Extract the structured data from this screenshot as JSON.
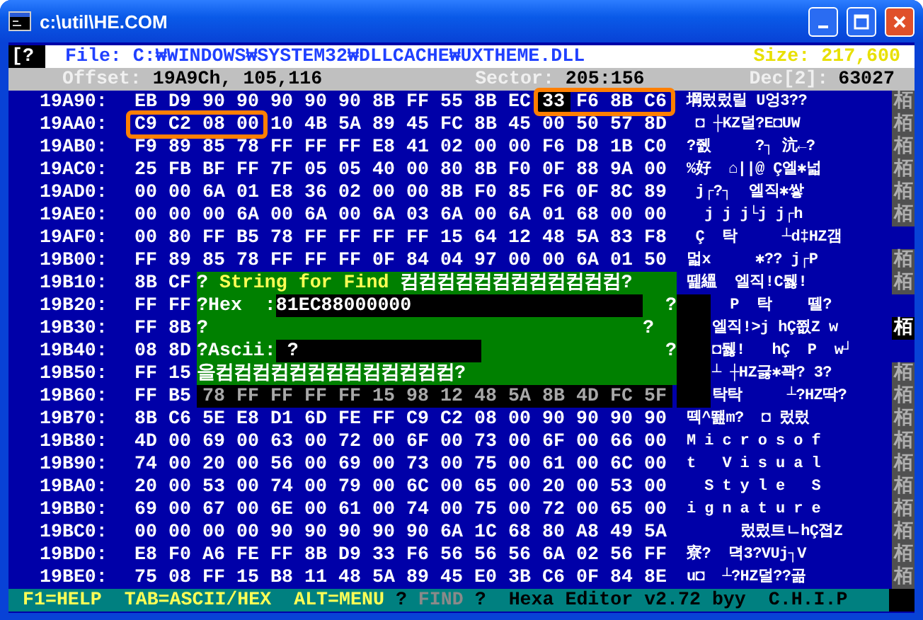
{
  "window": {
    "title": "c:\\util\\HE.COM"
  },
  "header": {
    "menu": "[?",
    "file_label": "File:",
    "file": "C:₩WINDOWS₩SYSTEM32₩DLLCACHE₩UXTHEME.DLL",
    "size_label": "Size:",
    "size": "217,600",
    "offset_label": "Offset:",
    "offset": "19A9Ch, 105,116",
    "sector_label": "Sector:",
    "sector": "205:156",
    "dec_label": "Dec[2]:",
    "dec": "63027"
  },
  "rows": [
    {
      "address": "19A90:",
      "kind": "normal",
      "bytes": "EB D9 90 90 90 90 90 8B FF 55 8B EC 33 F6 8B C6",
      "box_start": false,
      "box_end": true,
      "cursor": true,
      "ascii": "堈렀렀릴 U엉3??",
      "side": "栢",
      "side_selected": false
    },
    {
      "address": "19AA0:",
      "kind": "normal",
      "bytes": "C9 C2 08 00 10 4B 5A 89 45 FC 8B 45 00 50 57 8D",
      "box_start": true,
      "box_end": false,
      "cursor": false,
      "ascii": " ◘ ┼KZ덜?E◘UW",
      "side": "栢",
      "side_selected": false
    },
    {
      "address": "19AB0:",
      "kind": "normal",
      "bytes": "F9 89 85 78 FF FF FF E8 41 02 00 00 F6 D8 1B C0",
      "box_start": false,
      "box_end": false,
      "cursor": false,
      "ascii": "?쥀     ?┐ 沆←?",
      "side": "栢",
      "side_selected": false
    },
    {
      "address": "19AC0:",
      "kind": "normal",
      "bytes": "25 FB BF FF 7F 05 05 40 00 80 8B F0 0F 88 9A 00",
      "box_start": false,
      "box_end": false,
      "cursor": false,
      "ascii": "%好  ⌂||@ Ç엘✱넓",
      "side": "栢",
      "side_selected": false
    },
    {
      "address": "19AD0:",
      "kind": "normal",
      "bytes": "00 00 6A 01 E8 36 02 00 00 8B F0 85 F6 0F 8C 89",
      "box_start": false,
      "box_end": false,
      "cursor": false,
      "ascii": " j┌?┐  엘직✱쌓",
      "side": "栢",
      "side_selected": false
    },
    {
      "address": "19AE0:",
      "kind": "normal",
      "bytes": "00 00 00 6A 00 6A 00 6A 03 6A 00 6A 01 68 00 00",
      "box_start": false,
      "box_end": false,
      "cursor": false,
      "ascii": "  j j j└j j┌h",
      "side": "栢",
      "side_selected": false
    },
    {
      "address": "19AF0:",
      "kind": "normal",
      "bytes": "00 80 FF B5 78 FF FF FF FF 15 64 12 48 5A 83 F8",
      "box_start": false,
      "box_end": false,
      "cursor": false,
      "ascii": " Ç  탁     ┴d‡HZ갬"
    },
    {
      "address": "19B00:",
      "kind": "normal",
      "bytes": "FF 89 85 78 FF FF FF 0F 84 04 97 00 00 6A 01 50",
      "box_start": false,
      "box_end": false,
      "cursor": false,
      "ascii": "멃x     ✱?? j┌P",
      "side": "栢",
      "side_selected": false
    },
    {
      "address": "19B10:",
      "kind": "covered",
      "bytes": "8B CF",
      "box_start": false,
      "box_end": false,
      "cursor": false,
      "ascii": "뗉縕  엘직!C뒗!",
      "side": "栢",
      "side_selected": false
    },
    {
      "address": "19B20:",
      "kind": "covered",
      "bytes": "FF FF",
      "box_start": false,
      "box_end": false,
      "cursor": false,
      "ascii": "  P  탁    뗄?"
    },
    {
      "address": "19B30:",
      "kind": "covered",
      "bytes": "FF 8B",
      "box_start": false,
      "box_end": false,
      "cursor": false,
      "ascii": "엘직!>j hÇ쬢Z w",
      "side": "栢",
      "side_selected": true
    },
    {
      "address": "19B40:",
      "kind": "covered",
      "bytes": "08 8D",
      "box_start": false,
      "box_end": false,
      "cursor": false,
      "ascii": "◘뒗!   hÇ  P  w┘"
    },
    {
      "address": "19B50:",
      "kind": "covered",
      "bytes": "FF 15",
      "box_start": false,
      "box_end": false,
      "cursor": false,
      "ascii": "┴ ┼HZ긇✱꽉? 3?",
      "side": "栢",
      "side_selected": false
    },
    {
      "address": "19B60:",
      "kind": "shadowed",
      "bytes": "FF B5 78 FF FF FF FF 15 98 12 48 5A 8B 4D FC 5F",
      "box_start": false,
      "box_end": false,
      "cursor": false,
      "ascii": "탁탁     ┴?HZ딱?",
      "side": "栢",
      "side_selected": false
    },
    {
      "address": "19B70:",
      "kind": "normal",
      "bytes": "8B C6 5E E8 D1 6D FE FF C9 C2 08 00 90 90 90 90",
      "box_start": false,
      "box_end": false,
      "cursor": false,
      "ascii": "떽^뙖m?  ◘ 렀렀",
      "side": "栢",
      "side_selected": false
    },
    {
      "address": "19B80:",
      "kind": "normal",
      "bytes": "4D 00 69 00 63 00 72 00 6F 00 73 00 6F 00 66 00",
      "box_start": false,
      "box_end": false,
      "cursor": false,
      "ascii": "M i c r o s o f",
      "side": "栢",
      "side_selected": false
    },
    {
      "address": "19B90:",
      "kind": "normal",
      "bytes": "74 00 20 00 56 00 69 00 73 00 75 00 61 00 6C 00",
      "box_start": false,
      "box_end": false,
      "cursor": false,
      "ascii": "t   V i s u a l",
      "side": "栢",
      "side_selected": false
    },
    {
      "address": "19BA0:",
      "kind": "normal",
      "bytes": "20 00 53 00 74 00 79 00 6C 00 65 00 20 00 53 00",
      "box_start": false,
      "box_end": false,
      "cursor": false,
      "ascii": "  S t y l e   S",
      "side": "栢",
      "side_selected": false
    },
    {
      "address": "19BB0:",
      "kind": "normal",
      "bytes": "69 00 67 00 6E 00 61 00 74 00 75 00 72 00 65 00",
      "box_start": false,
      "box_end": false,
      "cursor": false,
      "ascii": "i g n a t u r e",
      "side": "栢",
      "side_selected": false
    },
    {
      "address": "19BC0:",
      "kind": "normal",
      "bytes": "00 00 00 00 90 90 90 90 90 6A 1C 68 80 A8 49 5A",
      "box_start": false,
      "box_end": false,
      "cursor": false,
      "ascii": "      렀렀트ㄴhÇ졉Z",
      "side": "栢",
      "side_selected": false
    },
    {
      "address": "19BD0:",
      "kind": "normal",
      "bytes": "E8 F0 A6 FE FF 8B D9 33 F6 56 56 56 6A 02 56 FF",
      "box_start": false,
      "box_end": false,
      "cursor": false,
      "ascii": "寮?  뎍3?VUj┐V",
      "side": "栢",
      "side_selected": false
    },
    {
      "address": "19BE0:",
      "kind": "normal",
      "bytes": "75 08 FF 15 B8 11 48 5A 89 45 E0 3B C6 0F 84 8E",
      "box_start": false,
      "box_end": false,
      "cursor": false,
      "ascii": "u◘  ┴?HZ덜??곪",
      "side": "栢",
      "side_selected": false
    }
  ],
  "dialog": {
    "lines": [
      {
        "kind": "title",
        "left": "?",
        "label": "String for Find",
        "right": "컴컴컴컴컴컴컴컴컴컴컴컴?"
      },
      {
        "kind": "field",
        "left": "?",
        "label": "Hex  :",
        "value": "81EC88000000",
        "right": "?"
      },
      {
        "kind": "blank",
        "left": "?",
        "right": "?"
      },
      {
        "kind": "field",
        "left": "?",
        "label": "Ascii:",
        "value": "?",
        "right": "?"
      },
      {
        "kind": "bottom",
        "left": "을",
        "right": "컴컴컴컴컴컴컴컴컴컴컴컴컴?"
      }
    ]
  },
  "status_bar": [
    {
      "kind": "key",
      "text": "F1=HELP"
    },
    {
      "kind": "key",
      "text": "TAB=ASCII/HEX"
    },
    {
      "kind": "key",
      "text": "ALT=MENU"
    },
    {
      "kind": "plain",
      "text": "?"
    },
    {
      "kind": "disabled",
      "text": "FIND"
    },
    {
      "kind": "plain",
      "text": "?"
    },
    {
      "kind": "plain",
      "text": "Hexa Editor v2.72 byy  C.H.I.P"
    }
  ]
}
